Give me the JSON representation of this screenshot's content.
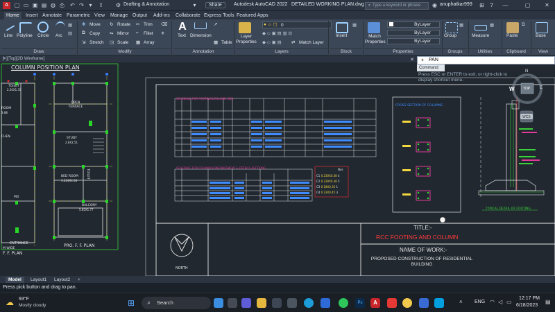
{
  "titlebar": {
    "workspace": "Drafting & Annotation",
    "share": "Share",
    "app_title": "Autodesk AutoCAD 2022",
    "file_title": "DETAILED WORKING PLAN.dwg",
    "search_placeholder": "Type a keyword or phrase",
    "user": "anuphatkar999"
  },
  "tabs": [
    "Home",
    "Insert",
    "Annotate",
    "Parametric",
    "View",
    "Manage",
    "Output",
    "Add-ins",
    "Collaborate",
    "Express Tools",
    "Featured Apps"
  ],
  "ribbon": {
    "draw": {
      "title": "Draw",
      "line": "Line",
      "polyline": "Polyline",
      "circle": "Circle",
      "arc": "Arc"
    },
    "modify": {
      "title": "Modify",
      "move": "Move",
      "rotate": "Rotate",
      "trim": "Trim",
      "copy": "Copy",
      "mirror": "Mirror",
      "fillet": "Fillet",
      "stretch": "Stretch",
      "scale": "Scale",
      "array": "Array"
    },
    "annotation": {
      "title": "Annotation",
      "text": "Text",
      "dimension": "Dimension",
      "table": "Table"
    },
    "layers": {
      "title": "Layers",
      "layer_properties": "Layer Properties",
      "layer_value": "0",
      "match_layer": "Match Layer"
    },
    "block": {
      "title": "Block",
      "insert": "Insert"
    },
    "properties": {
      "title": "Properties",
      "match": "Match Properties",
      "bylayer1": "ByLayer",
      "bylayer2": "ByLayer",
      "bylayer3": "ByLayer"
    },
    "groups": {
      "title": "Groups",
      "group": "Group"
    },
    "utilities": {
      "title": "Utilities",
      "measure": "Measure"
    },
    "clipboard": {
      "title": "Clipboard",
      "paste": "Paste"
    },
    "view": {
      "title": "View",
      "base": "Base"
    }
  },
  "command": {
    "current": "PAN",
    "hint": "Command",
    "message": "Press ESC or ENTER to exit, or right-click to display shortcut menu."
  },
  "viewcube": {
    "top": "TOP",
    "n": "N",
    "s": "S",
    "e": "E",
    "w": "W",
    "wcs": "WCS"
  },
  "viewport_label": "[−][Top][2D Wireframe]",
  "drawing": {
    "plan_title": "COLUMN POSITION PLAN",
    "rooms": [
      {
        "name": "TOILET",
        "dim": "2.20X1.35"
      },
      {
        "name": "OPEN TERRACE",
        "dim": ""
      },
      {
        "name": "STUDY",
        "dim": "2.8X2.51"
      },
      {
        "name": "BED ROOM",
        "dim": "3.224X4.58"
      },
      {
        "name": "BALCONY",
        "dim": "5.85X1.77"
      },
      {
        "name": "TOILET",
        "dim": ""
      },
      {
        "name": "ROOM",
        "dim": "3.88"
      },
      {
        "name": "CHEN",
        "dim": ""
      },
      {
        "name": "MD",
        "dim": ""
      }
    ],
    "entrance": "ENTRANCE",
    "wide_label": "M WIDE",
    "ff_plan_left": "F. F. PLAN",
    "ff_plan_center": "PRO. F. F. PLAN",
    "schedule1_title": "SCHEDULE FOR FOOTINGS/COLUMN SIZE",
    "schedule2_title": "SCHEDULE FOR COLUMN REINFORCEMENT & DETAILS SECTIONS",
    "cross_section_title": "CROSS SECTION OF COLUMNS",
    "typical_detail": "TYPICAL DETAIL OF FOOTING",
    "north": "NORTH",
    "title_label": "TITLE:-",
    "title_value": "RCC FOOTING AND COLUMN",
    "work_label": "NAME OF WORK:-",
    "work_value": "PROPOSED CONSTRUCTION OF RESIDENTIAL BUILDING",
    "small_table": {
      "header": "Nos",
      "rows": [
        [
          "C1",
          "0.230X0.38",
          "4"
        ],
        [
          "C2",
          "0.230X0.38",
          "5"
        ],
        [
          "C3",
          "0.18X0.35",
          "1"
        ],
        [
          "C4",
          "0.23X0.45",
          "3"
        ]
      ]
    }
  },
  "layout_tabs": [
    "Model",
    "Layout1",
    "Layout2"
  ],
  "cmdline": "Press pick button and drag to pan.",
  "taskbar": {
    "weather_temp": "93°F",
    "weather_desc": "Mostly cloudy",
    "search": "Search",
    "lang": "ENG",
    "time": "12:17 PM",
    "date": "6/18/2023"
  }
}
